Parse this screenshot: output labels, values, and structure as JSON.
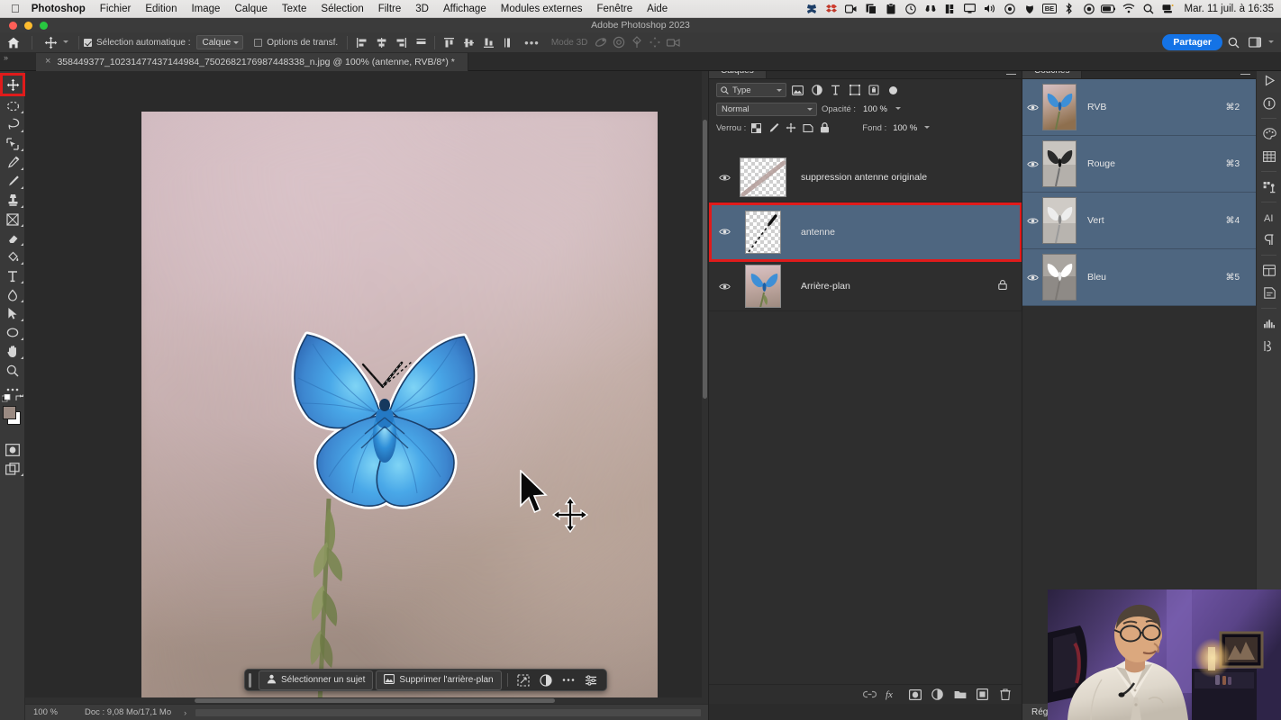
{
  "macos": {
    "apple_icon": "apple-logo",
    "app_name": "Photoshop",
    "menus": [
      "Fichier",
      "Edition",
      "Image",
      "Calque",
      "Texte",
      "Sélection",
      "Filtre",
      "3D",
      "Affichage",
      "Modules externes",
      "Fenêtre",
      "Aide"
    ],
    "status_icons": [
      "butterfly-icon",
      "dropbox-icon",
      "screen-record-icon",
      "copy-icon",
      "clipboard-icon",
      "clock-icon",
      "binoculars-icon",
      "stats-icon",
      "display-icon",
      "volume-icon",
      "record-icon",
      "vpn-icon"
    ],
    "badge_text": "BE",
    "status_icons_2": [
      "bluetooth-icon",
      "timemachine-icon",
      "battery-icon",
      "wifi-icon",
      "spotlight-icon",
      "controlcenter-icon"
    ],
    "clock": "Mar. 11 juil. à 16:35"
  },
  "window": {
    "title": "Adobe Photoshop 2023"
  },
  "options_bar": {
    "home_icon": "home-icon",
    "tool_icon": "move-tool-icon",
    "auto_select_label": "Sélection automatique :",
    "auto_select_value": "Calque",
    "transform_label": "Options de transf.",
    "align_icons": [
      "align-left-icon",
      "align-center-h-icon",
      "align-right-icon",
      "distribute-h-icon",
      "align-top-icon",
      "align-middle-v-icon",
      "align-bottom-icon",
      "distribute-v-icon"
    ],
    "more_label": "•••",
    "mode_3d_label": "Mode 3D",
    "icons_3d": [
      "3d-rotate-icon",
      "3d-roll-icon",
      "3d-drag-icon",
      "3d-slide-icon",
      "3d-camera-icon"
    ],
    "share_label": "Partager",
    "search_icon": "search-icon",
    "workspace_icon": "workspace-icon"
  },
  "tab_bar": {
    "chevrons": "»",
    "close_icon": "×",
    "document_title": "358449377_10231477437144984_7502682176987448338_n.jpg @ 100% (antenne, RVB/8*) *"
  },
  "toolbar": {
    "tools": [
      {
        "name": "move-tool",
        "icon": "move-icon",
        "selected": true
      },
      {
        "name": "marquee-tool",
        "icon": "ellipse-marquee-icon",
        "selected": false
      },
      {
        "name": "lasso-tool",
        "icon": "lasso-icon",
        "selected": false
      },
      {
        "name": "object-selection-tool",
        "icon": "object-select-icon",
        "selected": false
      },
      {
        "name": "healing-brush-tool",
        "icon": "healing-icon",
        "selected": false
      },
      {
        "name": "brush-tool",
        "icon": "brush-icon",
        "selected": false
      },
      {
        "name": "clone-stamp-tool",
        "icon": "stamp-icon",
        "selected": false
      },
      {
        "name": "history-brush-tool",
        "icon": "history-brush-icon",
        "selected": false
      },
      {
        "name": "eraser-tool",
        "icon": "eraser-icon",
        "selected": false
      },
      {
        "name": "gradient-tool",
        "icon": "paint-bucket-icon",
        "selected": false
      },
      {
        "name": "type-tool",
        "icon": "type-icon",
        "selected": false
      },
      {
        "name": "blur-tool",
        "icon": "blur-icon",
        "selected": false
      },
      {
        "name": "path-selection-tool",
        "icon": "path-arrow-icon",
        "selected": false
      },
      {
        "name": "shape-tool",
        "icon": "ellipse-shape-icon",
        "selected": false
      },
      {
        "name": "hand-tool",
        "icon": "hand-icon",
        "selected": false
      },
      {
        "name": "zoom-tool",
        "icon": "magnifier-icon",
        "selected": false
      },
      {
        "name": "more-tools",
        "icon": "ellipsis-icon",
        "selected": false
      }
    ],
    "foreground_color": "#9a8a82",
    "background_color": "#ffffff",
    "quickmask_icon": "quick-mask-icon",
    "screenmode_icon": "screen-mode-icon"
  },
  "canvas": {
    "subject": "common-blue-butterfly",
    "cursor_icon": "arrow-move-cursor",
    "antenna_selection": "dashed-antenna-selection"
  },
  "context_toolbar": {
    "select_subject_label": "Sélectionner un sujet",
    "select_subject_icon": "person-icon",
    "remove_bg_label": "Supprimer l'arrière-plan",
    "remove_bg_icon": "image-icon",
    "icons": [
      "transform-icon",
      "adjustment-icon",
      "more-icon",
      "settings-icon"
    ]
  },
  "status_bar": {
    "zoom": "100 %",
    "doc_info": "Doc : 9,08 Mo/17,1 Mo",
    "arrow": "›"
  },
  "layers_panel": {
    "tab_label": "Calques",
    "menu_icon": "panel-menu-icon",
    "filter_icon": "search-icon",
    "filter_label": "Type",
    "filter_icons": [
      "pixel-filter-icon",
      "adjustment-filter-icon",
      "type-filter-icon",
      "shape-filter-icon",
      "smartobject-filter-icon"
    ],
    "blend_mode": "Normal",
    "opacity_label": "Opacité :",
    "opacity_value": "100 %",
    "lock_label": "Verrou :",
    "lock_icons": [
      "lock-transparent-icon",
      "lock-image-icon",
      "lock-position-icon",
      "lock-artboard-icon",
      "lock-all-icon"
    ],
    "fill_label": "Fond :",
    "fill_value": "100 %",
    "layers": [
      {
        "name": "suppression antenne originale",
        "visible": true,
        "selected": false,
        "locked": false,
        "thumb": "stroke"
      },
      {
        "name": "antenne",
        "visible": true,
        "selected": true,
        "locked": false,
        "thumb": "antenna"
      },
      {
        "name": "Arrière-plan",
        "visible": true,
        "selected": false,
        "locked": true,
        "thumb": "photo"
      }
    ],
    "footer_icons": [
      "link-icon",
      "fx-icon",
      "mask-icon",
      "adjustment-layer-icon",
      "group-icon",
      "new-layer-icon",
      "delete-icon"
    ],
    "highlight_color": "#e01b1b"
  },
  "channels_panel": {
    "tab_label": "Couches",
    "menu_icon": "panel-menu-icon",
    "channels": [
      {
        "name": "RVB",
        "shortcut": "⌘2",
        "visible": true,
        "thumb": "color"
      },
      {
        "name": "Rouge",
        "shortcut": "⌘3",
        "visible": true,
        "thumb": "red"
      },
      {
        "name": "Vert",
        "shortcut": "⌘4",
        "visible": true,
        "thumb": "green"
      },
      {
        "name": "Bleu",
        "shortcut": "⌘5",
        "visible": true,
        "thumb": "blue"
      }
    ],
    "bottom_tab_label": "Réglag"
  },
  "right_rail": {
    "icons": [
      "play-icon",
      "info-icon",
      "color-swatches-icon",
      "grid-icon",
      "libraries-icon",
      "adobe-firefly-icon",
      "paragraph-icon",
      "layer-comps-icon",
      "notes-icon",
      "histogram-icon",
      "actions-icon"
    ]
  }
}
